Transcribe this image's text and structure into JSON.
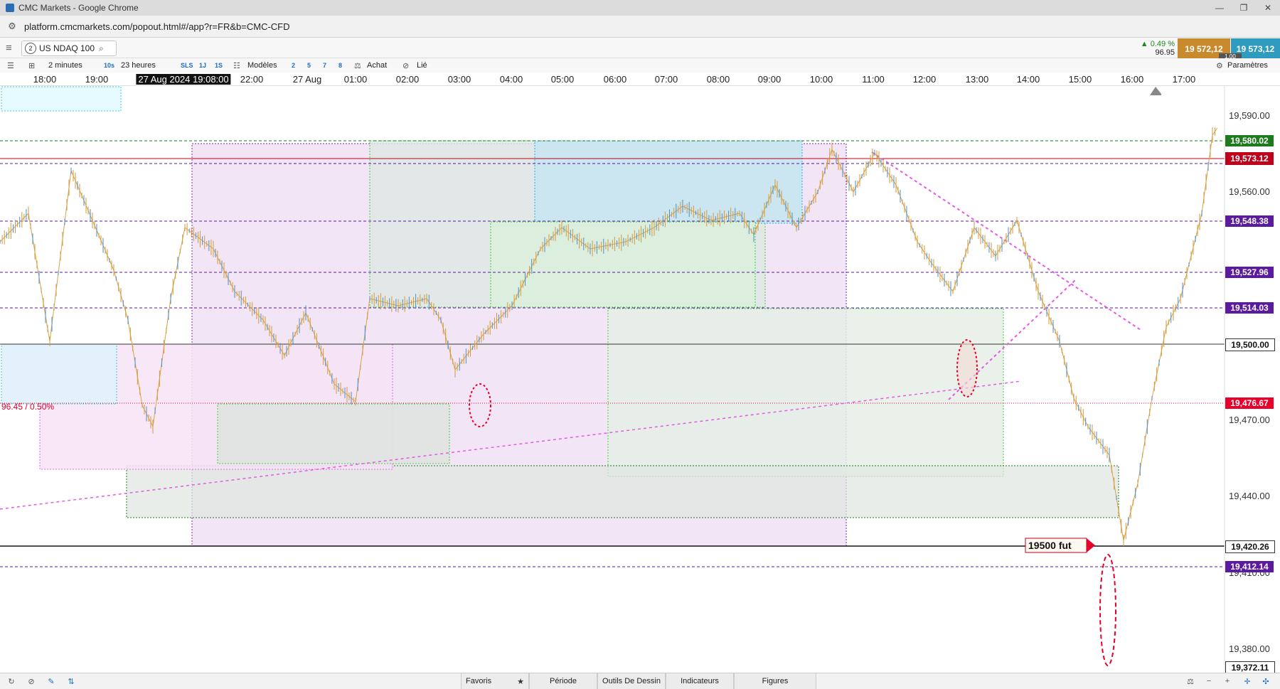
{
  "window": {
    "title": "CMC Markets - Google Chrome",
    "url": "platform.cmcmarkets.com/popout.html#/app?r=FR&b=CMC-CFD"
  },
  "toolbar": {
    "instrument_number": "2",
    "instrument": "US NDAQ 100",
    "interval": "2 minutes",
    "interval_short": "10s",
    "range": "23 heures",
    "sls": "SLS",
    "one_j": "1J",
    "one_s": "1S",
    "templates": "Modèles",
    "layouts": [
      "2",
      "5",
      "7",
      "8"
    ],
    "buy": "Achat",
    "linked": "Lié",
    "settings": "Paramètres"
  },
  "quote": {
    "change_pct": "▲ 0.49 %",
    "change_pts": "96.95",
    "sell": "19 572,12",
    "buy": "19 573,12",
    "spread": "1.00"
  },
  "time_axis": {
    "labels": [
      "18:00",
      "19:00",
      "27 Aug 2024 19:08:00",
      "22:00",
      "27 Aug",
      "01:00",
      "02:00",
      "03:00",
      "04:00",
      "05:00",
      "06:00",
      "07:00",
      "08:00",
      "09:00",
      "10:00",
      "11:00",
      "12:00",
      "13:00",
      "14:00",
      "15:00",
      "16:00",
      "17:00"
    ]
  },
  "price_axis": {
    "ticks": [
      "19,590.00",
      "19,560.00",
      "19,470.00",
      "19,440.00",
      "19,410.00",
      "19,380.00"
    ],
    "levels": [
      {
        "label": "19,580.02",
        "bg": "#1d7a1d"
      },
      {
        "label": "19,573.12",
        "bg": "#c0001a"
      },
      {
        "label": "19,548.38",
        "bg": "#5b1aa0"
      },
      {
        "label": "19,527.96",
        "bg": "#5b1aa0"
      },
      {
        "label": "19,514.03",
        "bg": "#5b1aa0"
      },
      {
        "label": "19,500.00",
        "bg": "#ffffff"
      },
      {
        "label": "19,476.67",
        "bg": "#e8002a"
      },
      {
        "label": "19,420.26",
        "bg": "#ffffff"
      },
      {
        "label": "19,412.14",
        "bg": "#5b1aa0"
      },
      {
        "label": "19,372.11",
        "bg": "#ffffff"
      }
    ]
  },
  "chart": {
    "change_label": "96.45 / 0.50%",
    "annotation": "19500 fut"
  },
  "bottom": {
    "favorites": "Favoris",
    "period": "Période",
    "drawing_tools": "Outils De Dessin",
    "indicators": "Indicateurs",
    "figures": "Figures"
  }
}
